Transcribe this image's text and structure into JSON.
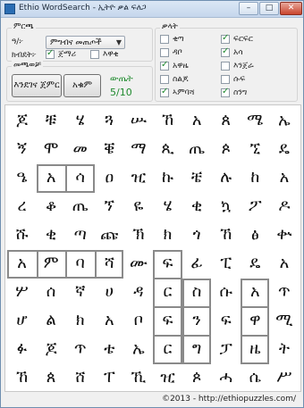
{
  "window": {
    "title": "Ethio WordSearch - ኢትዮ ቃል ፍለጋ",
    "min": "–",
    "max": "□",
    "close": "✕"
  },
  "options": {
    "group_label": "ምርጫ",
    "type_label": "ዓ/፦",
    "type_value": "ምግብና መጠጦች",
    "size_label": "ክብደት፦",
    "chk_start": "ጀማሪ",
    "chk_start_on": true,
    "chk_expert": "እዋቂ",
    "chk_expert_on": false
  },
  "game": {
    "group_label": "መጫወቻ",
    "new_button": "እንደገና ጀምር",
    "quit_button": "አቁም",
    "score_label": "ውጤት",
    "score_value": "5/10"
  },
  "words": {
    "group_label": "ቃላት",
    "items": [
      {
        "text": "ቂጣ",
        "on": false
      },
      {
        "text": "ፍርፍር",
        "on": true
      },
      {
        "text": "ዳቦ",
        "on": false
      },
      {
        "text": "አሳ",
        "on": true
      },
      {
        "text": "አዋዜ",
        "on": true
      },
      {
        "text": "እንጀራ",
        "on": false
      },
      {
        "text": "ስልጆ",
        "on": false
      },
      {
        "text": "ሱፍ",
        "on": false
      },
      {
        "text": "ኣምባሻ",
        "on": true
      },
      {
        "text": "ስንግ",
        "on": true
      }
    ]
  },
  "grid": {
    "rows": [
      [
        "ጆ",
        "ቹ",
        "ሄ",
        "ጓ",
        "ሡ",
        "ኸ",
        "አ",
        "ጰ",
        "ሜ",
        "ኤ"
      ],
      [
        "ኝ",
        "ሞ",
        "መ",
        "ቔ",
        "ማ",
        "ጲ",
        "ጤ",
        "ጶ",
        "ኚ",
        "ዴ"
      ],
      [
        "ዔ",
        "አ",
        "ሳ",
        "ዐ",
        "ዢ",
        "ኩ",
        "ቼ",
        "ሉ",
        "ከ",
        "አ"
      ],
      [
        "ረ",
        "ቆ",
        "ጤ",
        "ኘ",
        "ዬ",
        "ሄ",
        "ቂ",
        "ኳ",
        "ፖ",
        "ዶ"
      ],
      [
        "ሹ",
        "ቂ",
        "ጣ",
        "ጩ",
        "ኽ",
        "ክ",
        "ጎ",
        "ኸ",
        "ፅ",
        "ቍ"
      ],
      [
        "አ",
        "ም",
        "ባ",
        "ሻ",
        "ሙ",
        "ፍ",
        "ፊ",
        "ፒ",
        "ዴ",
        "አ"
      ],
      [
        "ሦ",
        "ሰ",
        "ኛ",
        "ሀ",
        "ዳ",
        "ር",
        "ስ",
        "ሱ",
        "አ",
        "ጥ"
      ],
      [
        "ሆ",
        "ል",
        "ክ",
        "አ",
        "ቦ",
        "ፍ",
        "ን",
        "ፍ",
        "ዋ",
        "ሚ"
      ],
      [
        "ፉ",
        "ጆ",
        "ጥ",
        "ቴ",
        "ኤ",
        "ር",
        "ግ",
        "ፓ",
        "ዜ",
        "ት"
      ],
      [
        "ኸ",
        "ጰ",
        "ሸ",
        "ፐ",
        "ኺ",
        "ዢ",
        "ጶ",
        "ሓ",
        "ሴ",
        "ሥ"
      ]
    ]
  },
  "status": {
    "text": "©2013 - http://ethiopuzzles.com/"
  }
}
